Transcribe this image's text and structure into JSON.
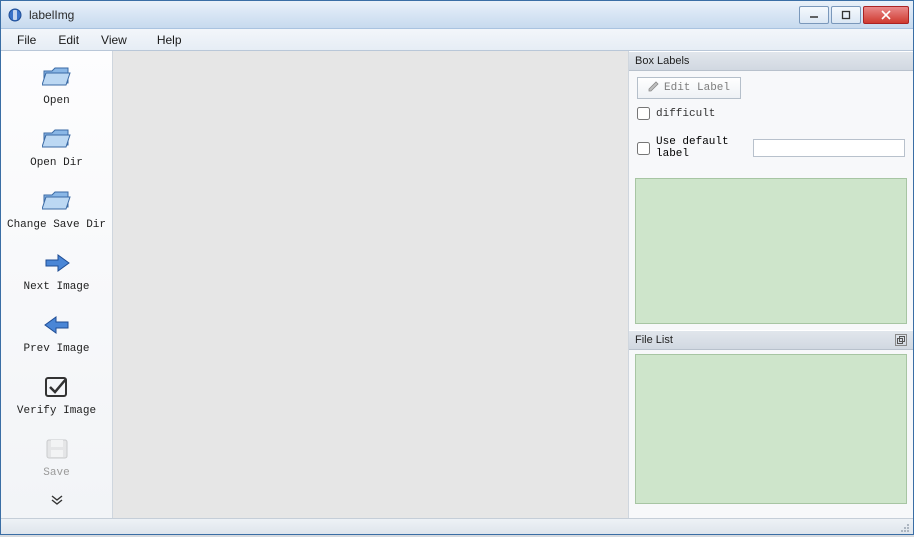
{
  "window": {
    "title": "labelImg"
  },
  "menu": {
    "file": "File",
    "edit": "Edit",
    "view": "View",
    "help": "Help"
  },
  "toolbar": {
    "open": "Open",
    "open_dir": "Open Dir",
    "change_save_dir": "Change Save Dir",
    "next_image": "Next Image",
    "prev_image": "Prev Image",
    "verify_image": "Verify Image",
    "save": "Save"
  },
  "right": {
    "box_labels_title": "Box Labels",
    "edit_label": "Edit Label",
    "difficult": "difficult",
    "use_default_label": "Use default label",
    "default_label_value": "",
    "file_list_title": "File List"
  }
}
